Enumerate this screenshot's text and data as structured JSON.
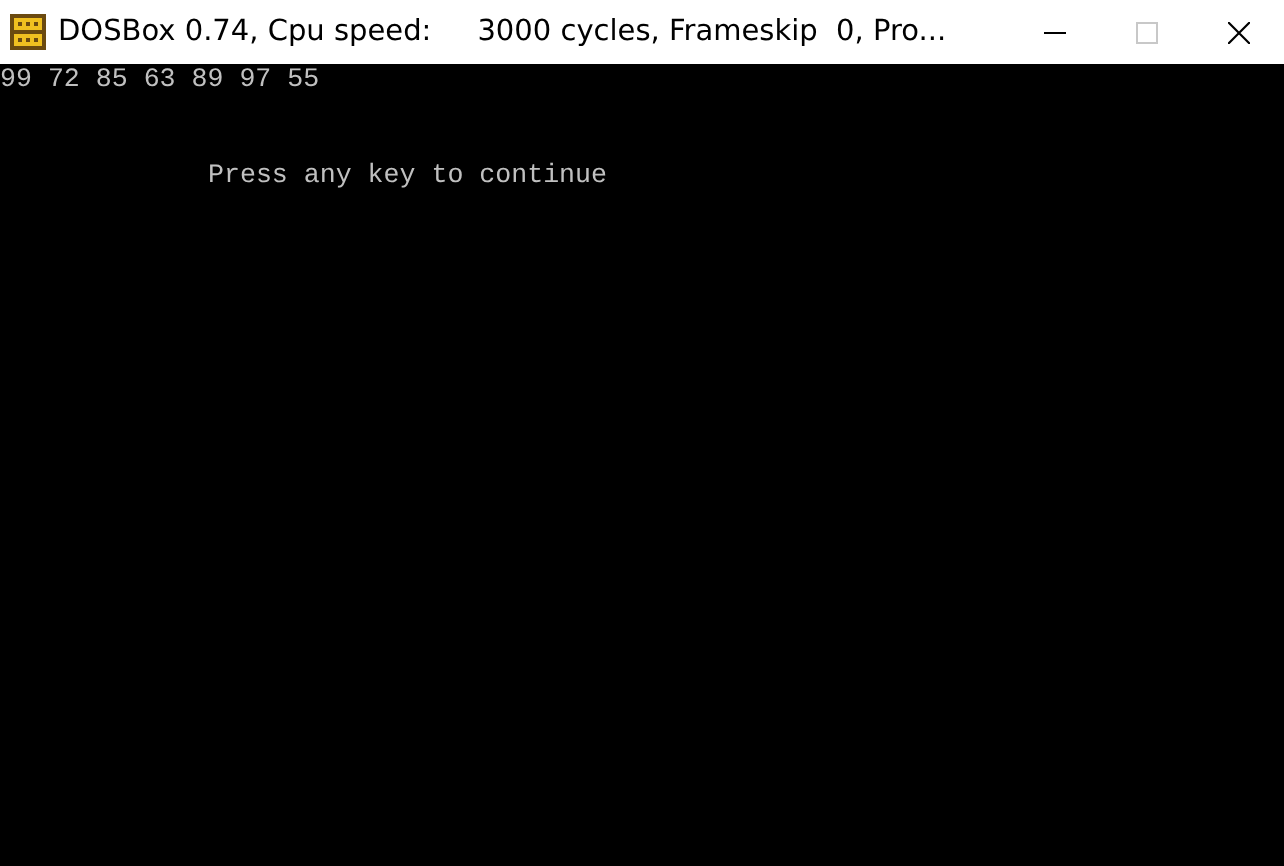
{
  "window": {
    "title": "DOSBox 0.74, Cpu speed:     3000 cycles, Frameskip  0, Pro...",
    "controls": [
      {
        "kind": "minimize",
        "disabled": false
      },
      {
        "kind": "maximize",
        "disabled": true
      },
      {
        "kind": "close",
        "disabled": false
      }
    ]
  },
  "console": {
    "output": "99 72 85 63 89 97 55",
    "prompt": "Press any key to continue"
  }
}
